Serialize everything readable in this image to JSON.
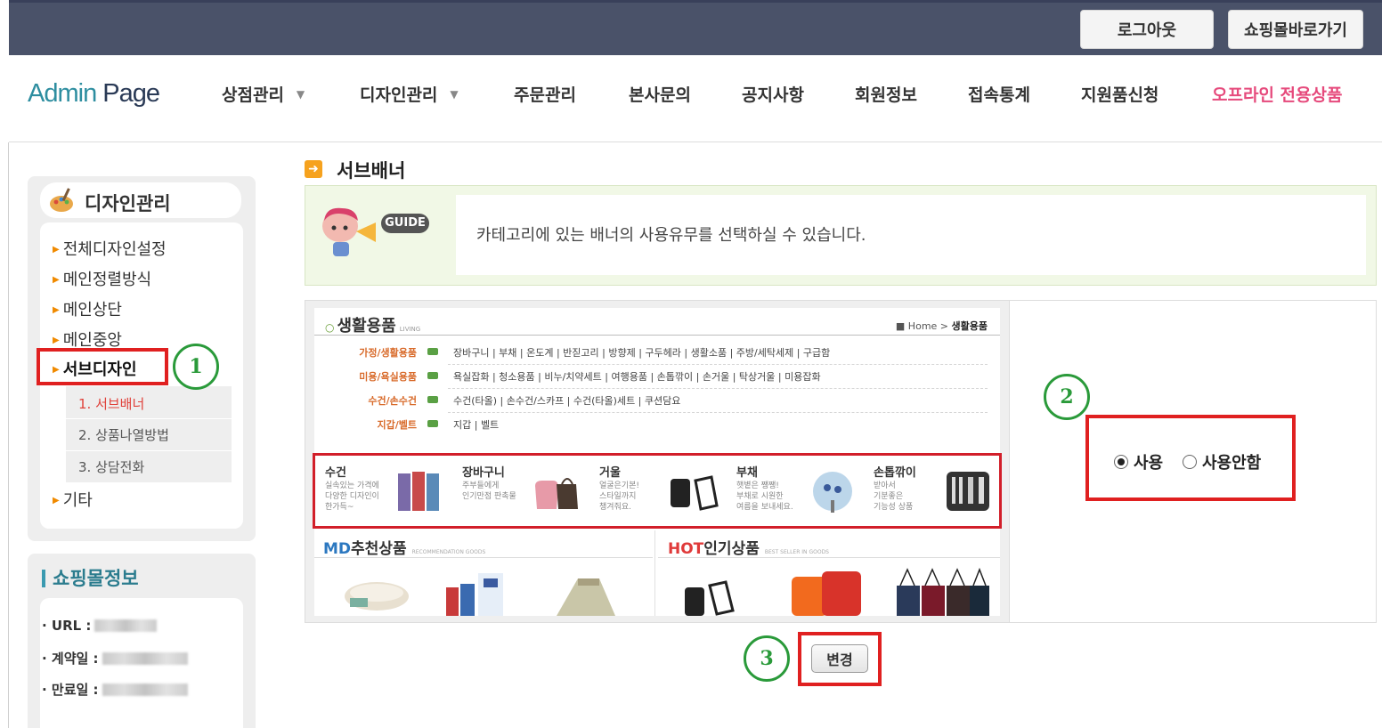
{
  "topbar": {
    "logout_label": "로그아웃",
    "mall_label": "쇼핑몰바로가기"
  },
  "nav": {
    "logo_part1": "Admin",
    "logo_part2": " Page",
    "items": [
      "상점관리",
      "디자인관리",
      "주문관리",
      "본사문의",
      "공지사항",
      "회원정보",
      "접속통계",
      "지원품신청",
      "오프라인 전용상품"
    ]
  },
  "sidebar": {
    "title": "디자인관리",
    "items": [
      "전체디자인설정",
      "메인정렬방식",
      "메인상단",
      "메인중앙",
      "서브디자인",
      "기타"
    ],
    "subitems": [
      "1. 서브배너",
      "2. 상품나열방법",
      "3. 상담전화"
    ],
    "active_item": "서브디자인",
    "active_subitem": "1. 서브배너"
  },
  "shop_info": {
    "title": "쇼핑몰정보",
    "rows": [
      {
        "label": "URL :"
      },
      {
        "label": "계약일 :"
      },
      {
        "label": "만료일 :"
      }
    ]
  },
  "page": {
    "heading": "서브배너",
    "guide_badge": "GUIDE",
    "guide_text": "카테고리에 있는 배너의 사용유무를 선택하실 수 있습니다."
  },
  "preview": {
    "title": "생활용품",
    "title_eng": "LIVING",
    "crumb_home": "■ Home > ",
    "crumb_current": "생활용품",
    "categories": [
      {
        "name": "가정/생활용품",
        "items": "장바구니 | 부채 | 온도계 | 반짇고리 | 방향제 | 구두헤라 | 생활소품 | 주방/세탁세제 | 구급함"
      },
      {
        "name": "미용/욕실용품",
        "items": "욕실잡화 | 청소용품 | 비누/치약세트 | 여행용품 | 손톱깎이 | 손거울 | 탁상거울 | 미용잡화"
      },
      {
        "name": "수건/손수건",
        "items": "수건(타올) | 손수건/스카프 | 수건(타올)세트 | 쿠션담요"
      },
      {
        "name": "지갑/벨트",
        "items": "지갑 | 벨트"
      }
    ],
    "products": [
      {
        "name": "수건",
        "desc": "실속있는 가격에\n다양한 디자인이\n한가득~"
      },
      {
        "name": "장바구니",
        "desc": "주부들에게\n인기만점 판촉물"
      },
      {
        "name": "거울",
        "desc": "얼굴은기본!\n스타일까지\n챙겨줘요."
      },
      {
        "name": "부채",
        "desc": "햇볕은 쨍쨍!\n부채로 시원한\n여름을 보내세요."
      },
      {
        "name": "손톱깎이",
        "desc": "받아서\n기분좋은\n기능성 상품"
      }
    ],
    "md_title_a": "MD",
    "md_title_b": "추천상품",
    "md_eng": "RECOMMENDATION GOODS",
    "hot_title_a": "HOT",
    "hot_title_b": "인기상품",
    "hot_eng": "BEST SELLER IN GOODS"
  },
  "options": {
    "use_label": "사용",
    "nouse_label": "사용안함",
    "selected": "사용"
  },
  "change_label": "변경",
  "steps": [
    "1",
    "2",
    "3"
  ],
  "colors": {
    "topbar": "#4a5269",
    "highlight": "#e02020",
    "step": "#2a9a3a",
    "pink_nav": "#e64a7c"
  }
}
